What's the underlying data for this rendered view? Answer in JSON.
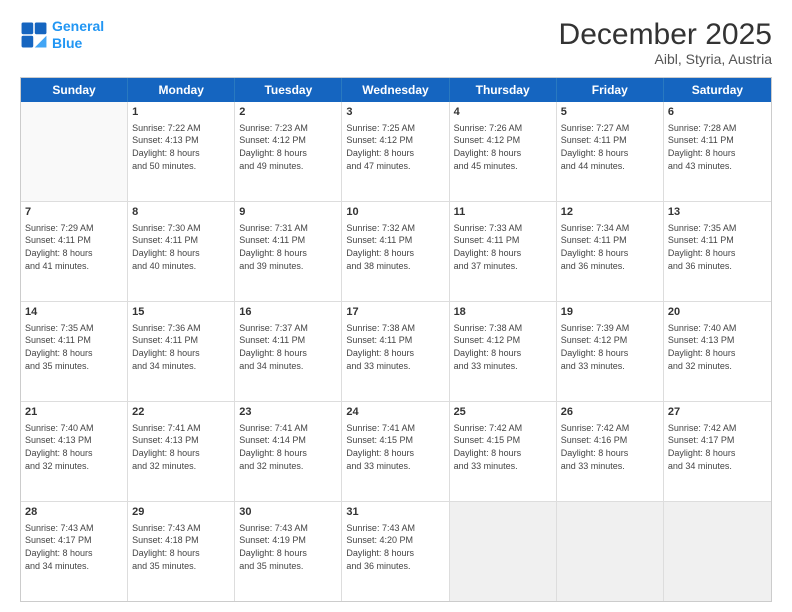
{
  "logo": {
    "line1": "General",
    "line2": "Blue"
  },
  "title": "December 2025",
  "subtitle": "Aibl, Styria, Austria",
  "days": [
    "Sunday",
    "Monday",
    "Tuesday",
    "Wednesday",
    "Thursday",
    "Friday",
    "Saturday"
  ],
  "weeks": [
    [
      {
        "day": "",
        "text": ""
      },
      {
        "day": "1",
        "text": "Sunrise: 7:22 AM\nSunset: 4:13 PM\nDaylight: 8 hours\nand 50 minutes."
      },
      {
        "day": "2",
        "text": "Sunrise: 7:23 AM\nSunset: 4:12 PM\nDaylight: 8 hours\nand 49 minutes."
      },
      {
        "day": "3",
        "text": "Sunrise: 7:25 AM\nSunset: 4:12 PM\nDaylight: 8 hours\nand 47 minutes."
      },
      {
        "day": "4",
        "text": "Sunrise: 7:26 AM\nSunset: 4:12 PM\nDaylight: 8 hours\nand 45 minutes."
      },
      {
        "day": "5",
        "text": "Sunrise: 7:27 AM\nSunset: 4:11 PM\nDaylight: 8 hours\nand 44 minutes."
      },
      {
        "day": "6",
        "text": "Sunrise: 7:28 AM\nSunset: 4:11 PM\nDaylight: 8 hours\nand 43 minutes."
      }
    ],
    [
      {
        "day": "7",
        "text": "Sunrise: 7:29 AM\nSunset: 4:11 PM\nDaylight: 8 hours\nand 41 minutes."
      },
      {
        "day": "8",
        "text": "Sunrise: 7:30 AM\nSunset: 4:11 PM\nDaylight: 8 hours\nand 40 minutes."
      },
      {
        "day": "9",
        "text": "Sunrise: 7:31 AM\nSunset: 4:11 PM\nDaylight: 8 hours\nand 39 minutes."
      },
      {
        "day": "10",
        "text": "Sunrise: 7:32 AM\nSunset: 4:11 PM\nDaylight: 8 hours\nand 38 minutes."
      },
      {
        "day": "11",
        "text": "Sunrise: 7:33 AM\nSunset: 4:11 PM\nDaylight: 8 hours\nand 37 minutes."
      },
      {
        "day": "12",
        "text": "Sunrise: 7:34 AM\nSunset: 4:11 PM\nDaylight: 8 hours\nand 36 minutes."
      },
      {
        "day": "13",
        "text": "Sunrise: 7:35 AM\nSunset: 4:11 PM\nDaylight: 8 hours\nand 36 minutes."
      }
    ],
    [
      {
        "day": "14",
        "text": "Sunrise: 7:35 AM\nSunset: 4:11 PM\nDaylight: 8 hours\nand 35 minutes."
      },
      {
        "day": "15",
        "text": "Sunrise: 7:36 AM\nSunset: 4:11 PM\nDaylight: 8 hours\nand 34 minutes."
      },
      {
        "day": "16",
        "text": "Sunrise: 7:37 AM\nSunset: 4:11 PM\nDaylight: 8 hours\nand 34 minutes."
      },
      {
        "day": "17",
        "text": "Sunrise: 7:38 AM\nSunset: 4:11 PM\nDaylight: 8 hours\nand 33 minutes."
      },
      {
        "day": "18",
        "text": "Sunrise: 7:38 AM\nSunset: 4:12 PM\nDaylight: 8 hours\nand 33 minutes."
      },
      {
        "day": "19",
        "text": "Sunrise: 7:39 AM\nSunset: 4:12 PM\nDaylight: 8 hours\nand 33 minutes."
      },
      {
        "day": "20",
        "text": "Sunrise: 7:40 AM\nSunset: 4:13 PM\nDaylight: 8 hours\nand 32 minutes."
      }
    ],
    [
      {
        "day": "21",
        "text": "Sunrise: 7:40 AM\nSunset: 4:13 PM\nDaylight: 8 hours\nand 32 minutes."
      },
      {
        "day": "22",
        "text": "Sunrise: 7:41 AM\nSunset: 4:13 PM\nDaylight: 8 hours\nand 32 minutes."
      },
      {
        "day": "23",
        "text": "Sunrise: 7:41 AM\nSunset: 4:14 PM\nDaylight: 8 hours\nand 32 minutes."
      },
      {
        "day": "24",
        "text": "Sunrise: 7:41 AM\nSunset: 4:15 PM\nDaylight: 8 hours\nand 33 minutes."
      },
      {
        "day": "25",
        "text": "Sunrise: 7:42 AM\nSunset: 4:15 PM\nDaylight: 8 hours\nand 33 minutes."
      },
      {
        "day": "26",
        "text": "Sunrise: 7:42 AM\nSunset: 4:16 PM\nDaylight: 8 hours\nand 33 minutes."
      },
      {
        "day": "27",
        "text": "Sunrise: 7:42 AM\nSunset: 4:17 PM\nDaylight: 8 hours\nand 34 minutes."
      }
    ],
    [
      {
        "day": "28",
        "text": "Sunrise: 7:43 AM\nSunset: 4:17 PM\nDaylight: 8 hours\nand 34 minutes."
      },
      {
        "day": "29",
        "text": "Sunrise: 7:43 AM\nSunset: 4:18 PM\nDaylight: 8 hours\nand 35 minutes."
      },
      {
        "day": "30",
        "text": "Sunrise: 7:43 AM\nSunset: 4:19 PM\nDaylight: 8 hours\nand 35 minutes."
      },
      {
        "day": "31",
        "text": "Sunrise: 7:43 AM\nSunset: 4:20 PM\nDaylight: 8 hours\nand 36 minutes."
      },
      {
        "day": "",
        "text": ""
      },
      {
        "day": "",
        "text": ""
      },
      {
        "day": "",
        "text": ""
      }
    ]
  ]
}
